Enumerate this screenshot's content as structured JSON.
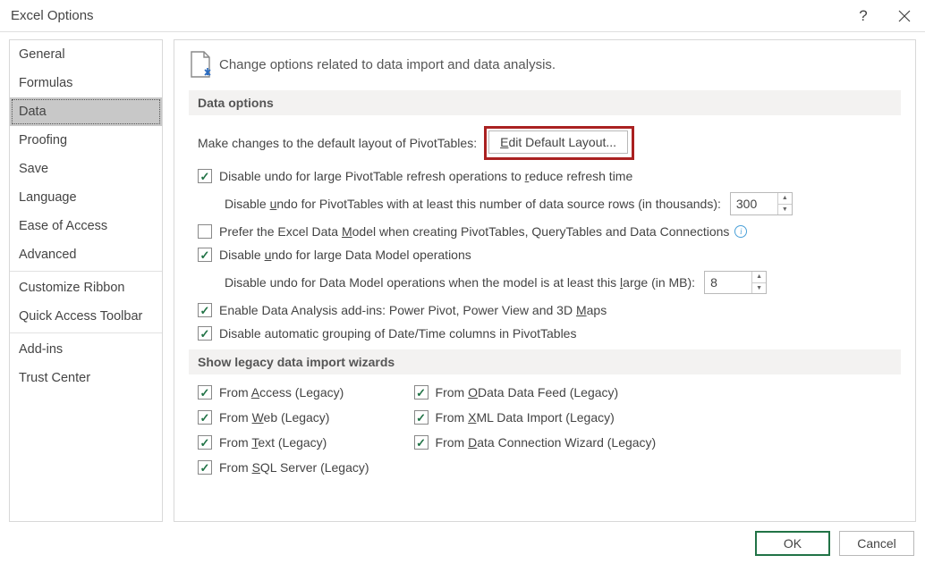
{
  "titlebar": {
    "title": "Excel Options",
    "help": "?",
    "close": "×"
  },
  "sidebar": {
    "items": [
      "General",
      "Formulas",
      "Data",
      "Proofing",
      "Save",
      "Language",
      "Ease of Access",
      "Advanced"
    ],
    "group2": [
      "Customize Ribbon",
      "Quick Access Toolbar"
    ],
    "group3": [
      "Add-ins",
      "Trust Center"
    ],
    "selected": "Data"
  },
  "content": {
    "introText": "Change options related to data import and data analysis.",
    "section1": "Data options",
    "section2": "Show legacy data import wizards",
    "pivotLabel": "Make changes to the default layout of PivotTables:",
    "editBtn": "Edit Default Layout...",
    "opt1": {
      "checked": true,
      "label": "Disable undo for large PivotTable refresh operations to reduce refresh time"
    },
    "opt2": {
      "label": "Disable undo for PivotTables with at least this number of data source rows (in thousands):",
      "value": "300"
    },
    "opt3": {
      "checked": false,
      "label": "Prefer the Excel Data Model when creating PivotTables, QueryTables and Data Connections"
    },
    "opt4": {
      "checked": true,
      "label": "Disable undo for large Data Model operations"
    },
    "opt5": {
      "label": "Disable undo for Data Model operations when the model is at least this large (in MB):",
      "value": "8"
    },
    "opt6": {
      "checked": true,
      "label": "Enable Data Analysis add-ins: Power Pivot, Power View and 3D Maps"
    },
    "opt7": {
      "checked": true,
      "label": "Disable automatic grouping of Date/Time columns in PivotTables"
    },
    "legacyCol1": [
      {
        "checked": true,
        "label": "From Access (Legacy)"
      },
      {
        "checked": true,
        "label": "From Web (Legacy)"
      },
      {
        "checked": true,
        "label": "From Text (Legacy)"
      },
      {
        "checked": true,
        "label": "From SQL Server (Legacy)"
      }
    ],
    "legacyCol2": [
      {
        "checked": true,
        "label": "From OData Data Feed (Legacy)"
      },
      {
        "checked": true,
        "label": "From XML Data Import (Legacy)"
      },
      {
        "checked": true,
        "label": "From Data Connection Wizard (Legacy)"
      }
    ]
  },
  "footer": {
    "ok": "OK",
    "cancel": "Cancel"
  }
}
